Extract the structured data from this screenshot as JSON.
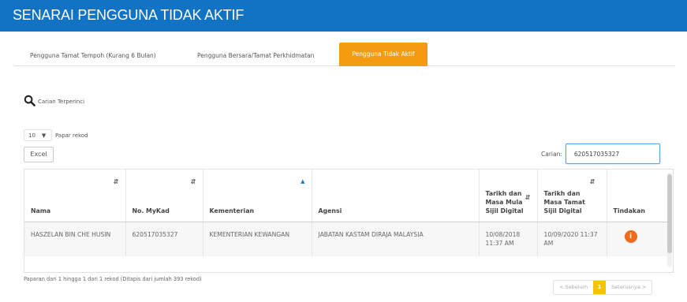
{
  "header": {
    "title": "SENARAI PENGGUNA TIDAK AKTIF"
  },
  "tabs": [
    {
      "label": "Pengguna Tamat Tempoh (Kurang 6 Bulan)",
      "active": false
    },
    {
      "label": "Pengguna Bersara/Tamat Perkhidmatan",
      "active": false
    },
    {
      "label": "Pengguna Tidak Aktif",
      "active": true
    }
  ],
  "advanced_search": {
    "icon": "search-icon",
    "label": "Carian Terperinci"
  },
  "page_size": {
    "value": "10",
    "icon": "chevron-down-icon",
    "label": "Papar rekod"
  },
  "toolbar": {
    "excel_label": "Excel"
  },
  "filter": {
    "label": "Carian:",
    "value": "620517035327"
  },
  "table": {
    "columns": [
      {
        "label": "Nama",
        "sort": "both"
      },
      {
        "label": "No. MyKad",
        "sort": "both"
      },
      {
        "label": "Kementerian",
        "sort": "asc"
      },
      {
        "label": "Agensi",
        "sort": "none"
      },
      {
        "label": "Tarikh dan Masa Mula Sijil Digital",
        "sort": "both"
      },
      {
        "label": "Tarikh dan Masa Tamat Sijil Digital",
        "sort": "both"
      },
      {
        "label": "Tindakan",
        "sort": "none"
      }
    ],
    "rows": [
      {
        "nama": "HASZELAN BIN CHE HUSIN",
        "mykad": "620517035327",
        "kementerian": "KEMENTERIAN KEWANGAN",
        "agensi": "JABATAN KASTAM DIRAJA MALAYSIA",
        "mula": "10/08/2018 11:37 AM",
        "tamat": "10/09/2020 11:37 AM",
        "action_icon": "info-circle-icon"
      }
    ]
  },
  "info_text": "Paparan dari 1 hingga 1 dari 1 rekod (Ditapis dari jumlah 393 rekod)",
  "pagination": {
    "prev": "< Sebelum",
    "current": "1",
    "next": "Seterusnya >"
  },
  "colors": {
    "header_bg": "#1272c4",
    "active_tab": "#f39c12",
    "action_button": "#ee6a1d",
    "current_page": "#f5c400"
  }
}
